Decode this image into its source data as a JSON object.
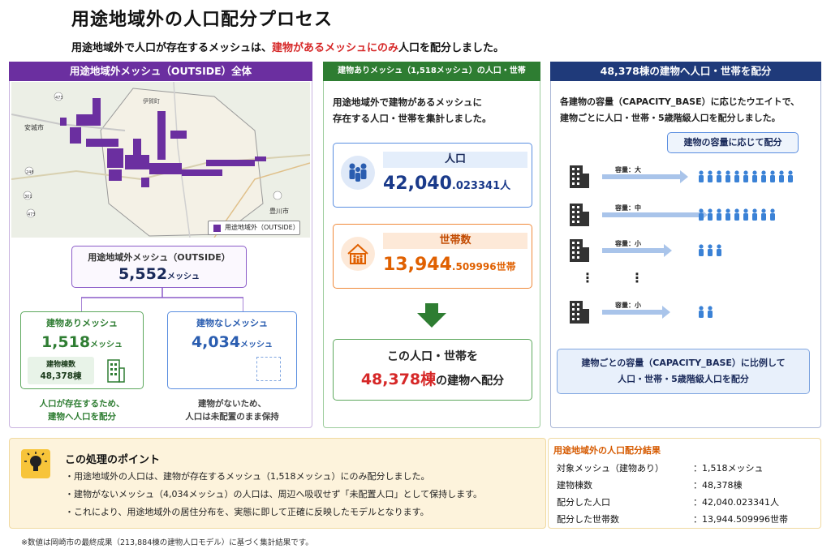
{
  "title": "用途地域外の人口配分プロセス",
  "subtitle": {
    "pre": "用途地域外で人口が存在するメッシュは、",
    "highlight": "建物があるメッシュにのみ",
    "post": "人口を配分しました。"
  },
  "panel1": {
    "header": "用途地域外メッシュ（OUTSIDE）全体",
    "map_labels": {
      "city_left": "安城市",
      "city_right": "豊川市",
      "road_1": "473",
      "road_2": "248",
      "road_3": "301",
      "road_4": "473",
      "route_name": "伊賀町"
    },
    "legend": "用途地域外（OUTSIDE）",
    "outside": {
      "label": "用途地域外メッシュ（OUTSIDE）",
      "value": "5,552",
      "unit": "メッシュ"
    },
    "with_buildings": {
      "label": "建物ありメッシュ",
      "value": "1,518",
      "unit": "メッシュ",
      "count_label": "建物棟数",
      "count_value": "48,378棟",
      "note1": "人口が存在するため、",
      "note2": "建物へ人口を配分"
    },
    "without_buildings": {
      "label": "建物なしメッシュ",
      "value": "4,034",
      "unit": "メッシュ",
      "note1": "建物がないため、",
      "note2": "人口は未配置のまま保持"
    }
  },
  "panel2": {
    "header": "建物ありメッシュ（1,518メッシュ）の人口・世帯",
    "desc1": "用途地域外で建物があるメッシュに",
    "desc2": "存在する人口・世帯を集計しました。",
    "population": {
      "label": "人口",
      "int": "42,040",
      "dec": ".023341",
      "unit": "人"
    },
    "households": {
      "label": "世帯数",
      "int": "13,944",
      "dec": ".509996",
      "unit": "世帯"
    },
    "alloc_line1": "この人口・世帯を",
    "alloc_red": "48,378棟",
    "alloc_line2": "の建物へ配分"
  },
  "panel3": {
    "header": "48,378棟の建物へ人口・世帯を配分",
    "desc1": "各建物の容量（CAPACITY_BASE）に応じたウエイトで、",
    "desc2": "建物ごとに人口・世帯・5歳階級人口を配分しました。",
    "bubble": "建物の容量に応じて配分",
    "rows": [
      {
        "label": "容量：大",
        "people": 11
      },
      {
        "label": "容量：中",
        "people": 9
      },
      {
        "label": "容量：小",
        "people": 3
      },
      {
        "label": "容量：小",
        "people": 2
      }
    ],
    "ellipsis": "⋮",
    "summary1": "建物ごとの容量（CAPACITY_BASE）に比例して",
    "summary2": "人口・世帯・5歳階級人口を配分"
  },
  "points": {
    "title": "この処理のポイント",
    "items": [
      "・用途地域外の人口は、建物が存在するメッシュ（1,518メッシュ）にのみ配分しました。",
      "・建物がないメッシュ（4,034メッシュ）の人口は、周辺へ吸収せず「未配置人口」として保持します。",
      "・これにより、用途地域外の居住分布を、実態に即して正確に反映したモデルとなります。"
    ]
  },
  "results": {
    "title": "用途地域外の人口配分結果",
    "rows": [
      {
        "k": "対象メッシュ（建物あり）",
        "v": "：1,518メッシュ"
      },
      {
        "k": "建物棟数",
        "v": "：48,378棟"
      },
      {
        "k": "配分した人口",
        "v": "：42,040.023341人"
      },
      {
        "k": "配分した世帯数",
        "v": "：13,944.509996世帯"
      }
    ]
  },
  "footnote": "※数値は岡崎市の最終成果（213,884棟の建物人口モデル）に基づく集計結果です。",
  "colors": {
    "purple": "#6b2fa0",
    "green": "#2e7d32",
    "navy": "#1f3a7a",
    "red": "#d62828",
    "orange": "#e06000"
  }
}
